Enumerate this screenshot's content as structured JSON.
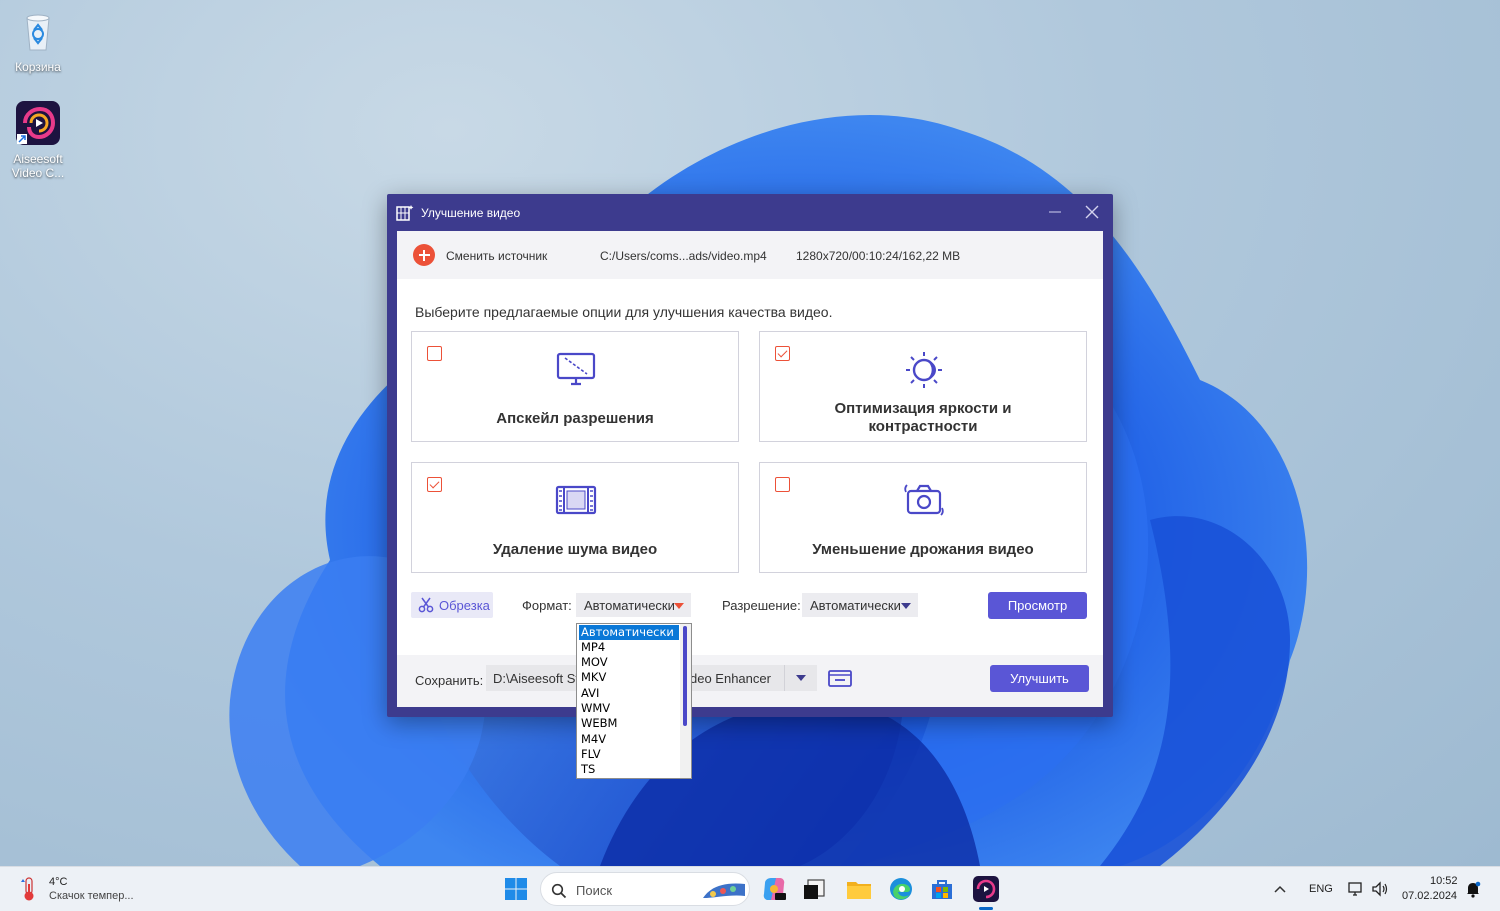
{
  "desktop": {
    "icons": [
      {
        "label": "Корзина"
      },
      {
        "label_line1": "Aiseesoft",
        "label_line2": "Video C..."
      }
    ]
  },
  "window": {
    "title": "Улучшение видео",
    "source": {
      "change_label": "Сменить источник",
      "path": "C:/Users/coms...ads/video.mp4",
      "info": "1280x720/00:10:24/162,22 MB"
    },
    "instruction": "Выберите предлагаемые опции для улучшения качества видео.",
    "options": [
      {
        "label": "Апскейл разрешения",
        "checked": false,
        "icon": "monitor-icon"
      },
      {
        "label_line1": "Оптимизация яркости и",
        "label_line2": "контрастности",
        "checked": true,
        "icon": "brightness-icon"
      },
      {
        "label": "Удаление шума видео",
        "checked": true,
        "icon": "film-icon"
      },
      {
        "label": "Уменьшение дрожания видео",
        "checked": false,
        "icon": "camera-icon"
      }
    ],
    "trim_label": "Обрезка",
    "format_label": "Формат:",
    "format_value": "Автоматически",
    "resolution_label": "Разрешение:",
    "resolution_value": "Автоматически",
    "preview_label": "Просмотр",
    "save_label": "Сохранить:",
    "save_path": "D:\\Aiseesoft St",
    "save_path_tail": "deo Enhancer",
    "enhance_label": "Улучшить",
    "accent_color": "#5a56d6",
    "check_color": "#ec5138"
  },
  "format_dropdown": {
    "items": [
      "Автоматически",
      "MP4",
      "MOV",
      "MKV",
      "AVI",
      "WMV",
      "WEBM",
      "M4V",
      "FLV",
      "TS"
    ],
    "selected_index": 0
  },
  "taskbar": {
    "weather_temp": "4°C",
    "weather_text": "Скачок темпер...",
    "search_placeholder": "Поиск",
    "language": "ENG",
    "time": "10:52",
    "date": "07.02.2024"
  }
}
